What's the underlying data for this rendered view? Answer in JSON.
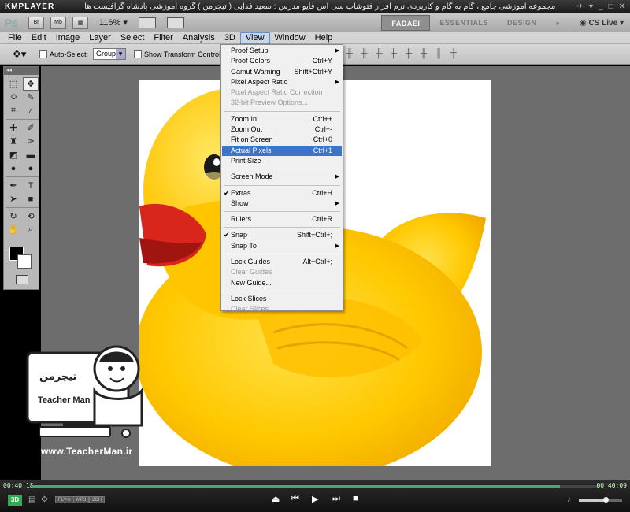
{
  "kmplayer": {
    "logo": "KMPLAYER",
    "title": "مجموعه آموزشی جامع ، گام به گام و کاربردی نرم افزار فتوشاپ سی اس فایو  مدرس : سعید فدایی ( تیچرمن ) گروه آموزشی پادشاه گرافیست ها",
    "time_current": "00:40:18",
    "time_total": "00:40:09",
    "progress": 0.93,
    "volume": 0.6,
    "badges": [
      "FLV-h",
      "MP3",
      "2CH"
    ],
    "badge_3d": "3D"
  },
  "ps_appbar": {
    "logo": "Ps",
    "btn_br": "Br",
    "btn_mb": "Mb",
    "zoom": "116%",
    "workspaces": [
      "FADAEI",
      "ESSENTIALS",
      "DESIGN"
    ],
    "active_workspace": "FADAEI",
    "more": "»",
    "cs_live": "CS Live"
  },
  "menubar": {
    "items": [
      "File",
      "Edit",
      "Image",
      "Layer",
      "Select",
      "Filter",
      "Analysis",
      "3D",
      "View",
      "Window",
      "Help"
    ],
    "active": "View"
  },
  "options": {
    "auto_select_label": "Auto-Select:",
    "auto_select_value": "Group",
    "transform_label": "Show Transform Controls"
  },
  "view_menu": {
    "items": [
      {
        "label": "Proof Setup",
        "shortcut": "",
        "submenu": true
      },
      {
        "label": "Proof Colors",
        "shortcut": "Ctrl+Y"
      },
      {
        "label": "Gamut Warning",
        "shortcut": "Shift+Ctrl+Y"
      },
      {
        "label": "Pixel Aspect Ratio",
        "shortcut": "",
        "submenu": true
      },
      {
        "label": "Pixel Aspect Ratio Correction",
        "shortcut": "",
        "disabled": true
      },
      {
        "label": "32-bit Preview Options...",
        "shortcut": "",
        "disabled": true
      },
      {
        "sep": true
      },
      {
        "label": "Zoom In",
        "shortcut": "Ctrl++"
      },
      {
        "label": "Zoom Out",
        "shortcut": "Ctrl+-"
      },
      {
        "label": "Fit on Screen",
        "shortcut": "Ctrl+0"
      },
      {
        "label": "Actual Pixels",
        "shortcut": "Ctrl+1",
        "highlighted": true
      },
      {
        "label": "Print Size",
        "shortcut": ""
      },
      {
        "sep": true
      },
      {
        "label": "Screen Mode",
        "shortcut": "",
        "submenu": true
      },
      {
        "sep": true
      },
      {
        "label": "Extras",
        "shortcut": "Ctrl+H",
        "checked": true
      },
      {
        "label": "Show",
        "shortcut": "",
        "submenu": true
      },
      {
        "sep": true
      },
      {
        "label": "Rulers",
        "shortcut": "Ctrl+R"
      },
      {
        "sep": true
      },
      {
        "label": "Snap",
        "shortcut": "Shift+Ctrl+;",
        "checked": true
      },
      {
        "label": "Snap To",
        "shortcut": "",
        "submenu": true
      },
      {
        "sep": true
      },
      {
        "label": "Lock Guides",
        "shortcut": "Alt+Ctrl+;"
      },
      {
        "label": "Clear Guides",
        "shortcut": "",
        "disabled": true
      },
      {
        "label": "New Guide...",
        "shortcut": ""
      },
      {
        "sep": true
      },
      {
        "label": "Lock Slices",
        "shortcut": ""
      },
      {
        "label": "Clear Slices",
        "shortcut": "",
        "disabled": true
      }
    ]
  },
  "teacher": {
    "name": "Teacher Man",
    "persian_name": "تیچرمن",
    "website": "www.TeacherMan.ir"
  },
  "colors": {
    "duck": "#ffd400",
    "beak": "#d8261c",
    "highlight": "#3b75c8"
  }
}
